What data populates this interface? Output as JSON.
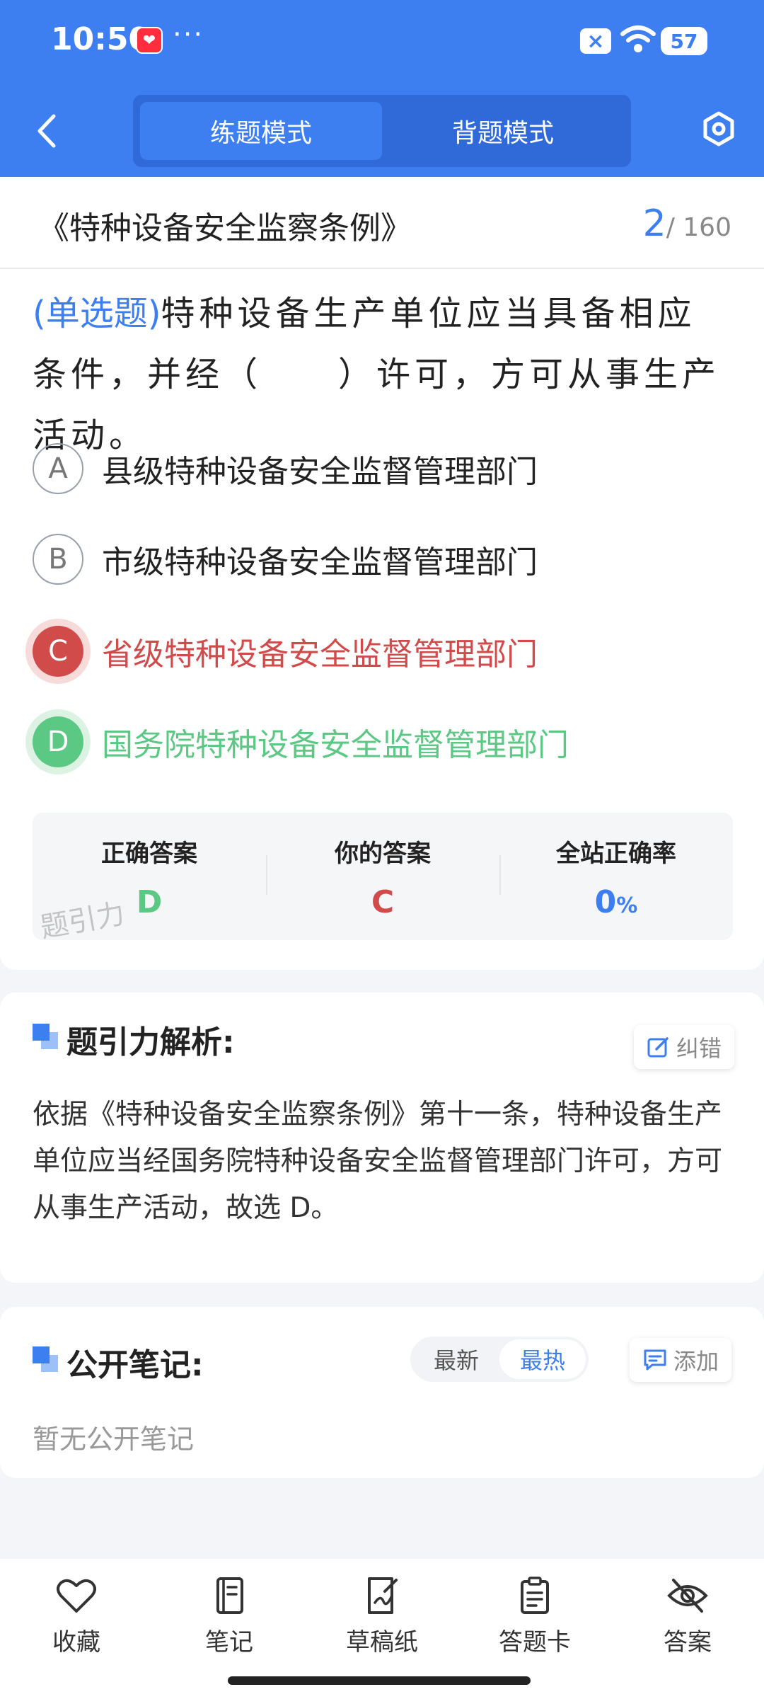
{
  "status_bar": {
    "time": "10:50",
    "more": "···",
    "battery": "57"
  },
  "header": {
    "tabs": [
      {
        "label": "练题模式",
        "active": true
      },
      {
        "label": "背题模式",
        "active": false
      }
    ]
  },
  "title_row": {
    "title": "《特种设备安全监察条例》",
    "current": "2",
    "total": "/ 160"
  },
  "question": {
    "type": "(单选题)",
    "text": "特种设备生产单位应当具备相应条件，并经（　　）许可，方可从事生产活动。"
  },
  "options": [
    {
      "letter": "A",
      "text": "县级特种设备安全监督管理部门",
      "state": "normal"
    },
    {
      "letter": "B",
      "text": "市级特种设备安全监督管理部门",
      "state": "normal"
    },
    {
      "letter": "C",
      "text": "省级特种设备安全监督管理部门",
      "state": "wrong"
    },
    {
      "letter": "D",
      "text": "国务院特种设备安全监督管理部门",
      "state": "correct"
    }
  ],
  "answer_summary": {
    "correct_label": "正确答案",
    "correct_value": "D",
    "yours_label": "你的答案",
    "yours_value": "C",
    "rate_label": "全站正确率",
    "rate_value": "0",
    "rate_unit": "%",
    "watermark": "题引力"
  },
  "analysis": {
    "title": "题引力解析:",
    "correct_btn": "纠错",
    "text": "依据《特种设备安全监察条例》第十一条，特种设备生产单位应当经国务院特种设备安全监督管理部门许可，方可从事生产活动，故选 D。"
  },
  "notes": {
    "title": "公开笔记:",
    "sort_latest": "最新",
    "sort_hot": "最热",
    "add_btn": "添加",
    "empty": "暂无公开笔记"
  },
  "bottom_nav": [
    {
      "label": "收藏",
      "icon": "heart-icon"
    },
    {
      "label": "笔记",
      "icon": "notebook-icon"
    },
    {
      "label": "草稿纸",
      "icon": "draft-icon"
    },
    {
      "label": "答题卡",
      "icon": "clipboard-icon"
    },
    {
      "label": "答案",
      "icon": "eye-off-icon"
    }
  ],
  "colors": {
    "brand": "#3d7ff0",
    "wrong": "#d24b4b",
    "correct": "#5bc884"
  }
}
